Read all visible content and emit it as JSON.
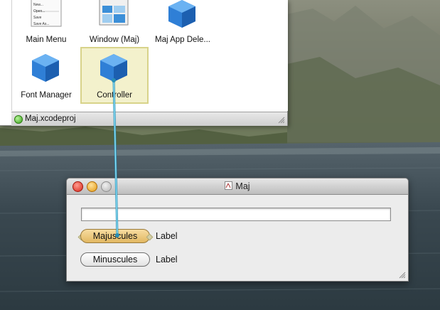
{
  "doc_window": {
    "items": [
      {
        "label": "Main Menu",
        "icon": "main-menu-icon"
      },
      {
        "label": "Window (Maj)",
        "icon": "window-icon"
      },
      {
        "label": "Maj App Dele...",
        "icon": "blue-cube-icon"
      },
      {
        "label": "Font Manager",
        "icon": "blue-cube-icon"
      },
      {
        "label": "Controller",
        "icon": "blue-cube-icon"
      }
    ],
    "menu_preview": [
      "New...",
      "Open...",
      "Save",
      "Save As..."
    ],
    "status_label": "Maj.xcodeproj"
  },
  "app_window": {
    "title": "Maj",
    "text_field_value": "",
    "majuscules_button": "Majuscules",
    "minuscules_button": "Minuscules",
    "label_1": "Label",
    "label_2": "Label"
  },
  "colors": {
    "selection_fill": "#f3f1cc",
    "selection_border": "#d8d38a",
    "connection_line": "#5bbcd8",
    "cube_blue": "#2f7fd6"
  }
}
